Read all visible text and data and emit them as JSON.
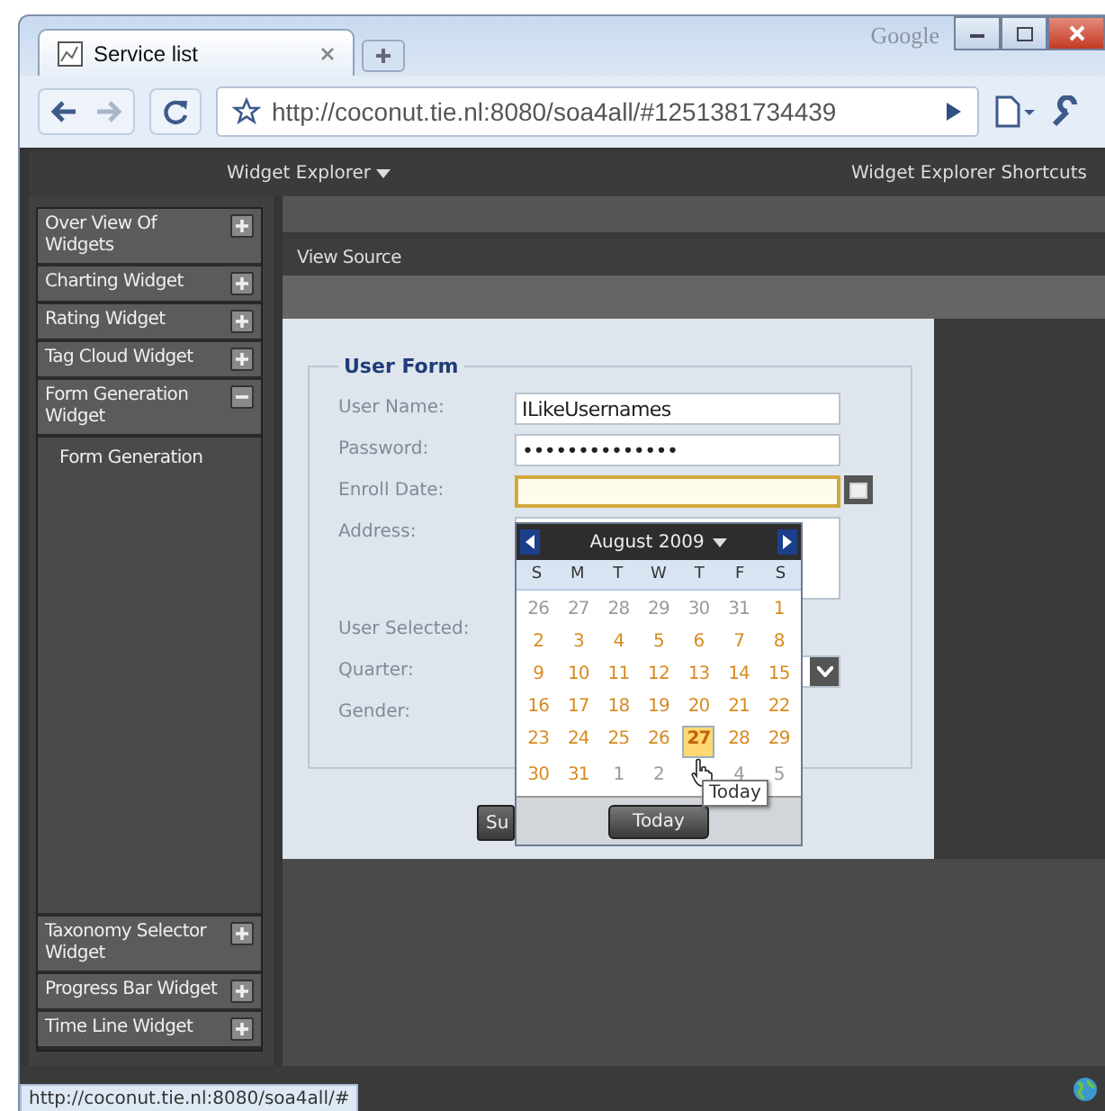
{
  "browser": {
    "brand": "Google",
    "tabs": [
      {
        "title": "Service list",
        "selected": true
      }
    ],
    "url": "http://coconut.tie.nl:8080/soa4all/#1251381734439"
  },
  "app": {
    "menu": "Widget Explorer",
    "shortcuts": "Widget Explorer Shortcuts"
  },
  "sidebar": {
    "items": [
      {
        "label": "Over View Of Widgets",
        "expanded": false
      },
      {
        "label": "Charting Widget",
        "expanded": false
      },
      {
        "label": "Rating Widget",
        "expanded": false
      },
      {
        "label": "Tag Cloud Widget",
        "expanded": false
      },
      {
        "label": "Form Generation Widget",
        "expanded": true,
        "children": [
          {
            "label": "Form Generation"
          }
        ]
      },
      {
        "label": "Taxonomy Selector Widget",
        "expanded": false
      },
      {
        "label": "Progress Bar Widget",
        "expanded": false
      },
      {
        "label": "Time Line Widget",
        "expanded": false
      }
    ]
  },
  "toolbar": {
    "view_source": "View Source"
  },
  "form": {
    "legend": "User Form",
    "fields": [
      {
        "kind": "text",
        "label": "User Name:",
        "value": "ILikeUsernames",
        "focused": false
      },
      {
        "kind": "text",
        "label": "Password:",
        "value": "••••••••••••••",
        "focused": false
      },
      {
        "kind": "date",
        "label": "Enroll Date:",
        "focused": true
      },
      {
        "kind": "textarea",
        "label": "Address:",
        "focused": false
      },
      {
        "kind": "none",
        "label": "User Selected:"
      },
      {
        "kind": "select",
        "label": "Quarter:",
        "focused": false
      },
      {
        "kind": "none",
        "label": "Gender:"
      }
    ],
    "buttons": [
      "Su"
    ]
  },
  "calendar": {
    "month": "August 2009",
    "weekdays": [
      "S",
      "M",
      "T",
      "W",
      "T",
      "F",
      "S"
    ],
    "weeks": [
      [
        {
          "d": "26",
          "other_month": true,
          "selected": false
        },
        {
          "d": "27",
          "other_month": true,
          "selected": false
        },
        {
          "d": "28",
          "other_month": true,
          "selected": false
        },
        {
          "d": "29",
          "other_month": true,
          "selected": false
        },
        {
          "d": "30",
          "other_month": true,
          "selected": false
        },
        {
          "d": "31",
          "other_month": true,
          "selected": false
        },
        {
          "d": "1",
          "other_month": false,
          "selected": false
        }
      ],
      [
        {
          "d": "2",
          "other_month": false,
          "selected": false
        },
        {
          "d": "3",
          "other_month": false,
          "selected": false
        },
        {
          "d": "4",
          "other_month": false,
          "selected": false
        },
        {
          "d": "5",
          "other_month": false,
          "selected": false
        },
        {
          "d": "6",
          "other_month": false,
          "selected": false
        },
        {
          "d": "7",
          "other_month": false,
          "selected": false
        },
        {
          "d": "8",
          "other_month": false,
          "selected": false
        }
      ],
      [
        {
          "d": "9",
          "other_month": false,
          "selected": false
        },
        {
          "d": "10",
          "other_month": false,
          "selected": false
        },
        {
          "d": "11",
          "other_month": false,
          "selected": false
        },
        {
          "d": "12",
          "other_month": false,
          "selected": false
        },
        {
          "d": "13",
          "other_month": false,
          "selected": false
        },
        {
          "d": "14",
          "other_month": false,
          "selected": false
        },
        {
          "d": "15",
          "other_month": false,
          "selected": false
        }
      ],
      [
        {
          "d": "16",
          "other_month": false,
          "selected": false
        },
        {
          "d": "17",
          "other_month": false,
          "selected": false
        },
        {
          "d": "18",
          "other_month": false,
          "selected": false
        },
        {
          "d": "19",
          "other_month": false,
          "selected": false
        },
        {
          "d": "20",
          "other_month": false,
          "selected": false
        },
        {
          "d": "21",
          "other_month": false,
          "selected": false
        },
        {
          "d": "22",
          "other_month": false,
          "selected": false
        }
      ],
      [
        {
          "d": "23",
          "other_month": false,
          "selected": false
        },
        {
          "d": "24",
          "other_month": false,
          "selected": false
        },
        {
          "d": "25",
          "other_month": false,
          "selected": false
        },
        {
          "d": "26",
          "other_month": false,
          "selected": false
        },
        {
          "d": "27",
          "other_month": false,
          "selected": true
        },
        {
          "d": "28",
          "other_month": false,
          "selected": false
        },
        {
          "d": "29",
          "other_month": false,
          "selected": false
        }
      ],
      [
        {
          "d": "30",
          "other_month": false,
          "selected": false
        },
        {
          "d": "31",
          "other_month": false,
          "selected": false
        },
        {
          "d": "1",
          "other_month": true,
          "selected": false
        },
        {
          "d": "2",
          "other_month": true,
          "selected": false
        },
        {
          "selected": false
        },
        {
          "d": "4",
          "other_month": true,
          "selected": false
        },
        {
          "d": "5",
          "other_month": true,
          "selected": false
        }
      ]
    ],
    "today_button": "Today",
    "tooltip": "Today"
  },
  "status": {
    "url": "http://coconut.tie.nl:8080/soa4all/#"
  }
}
